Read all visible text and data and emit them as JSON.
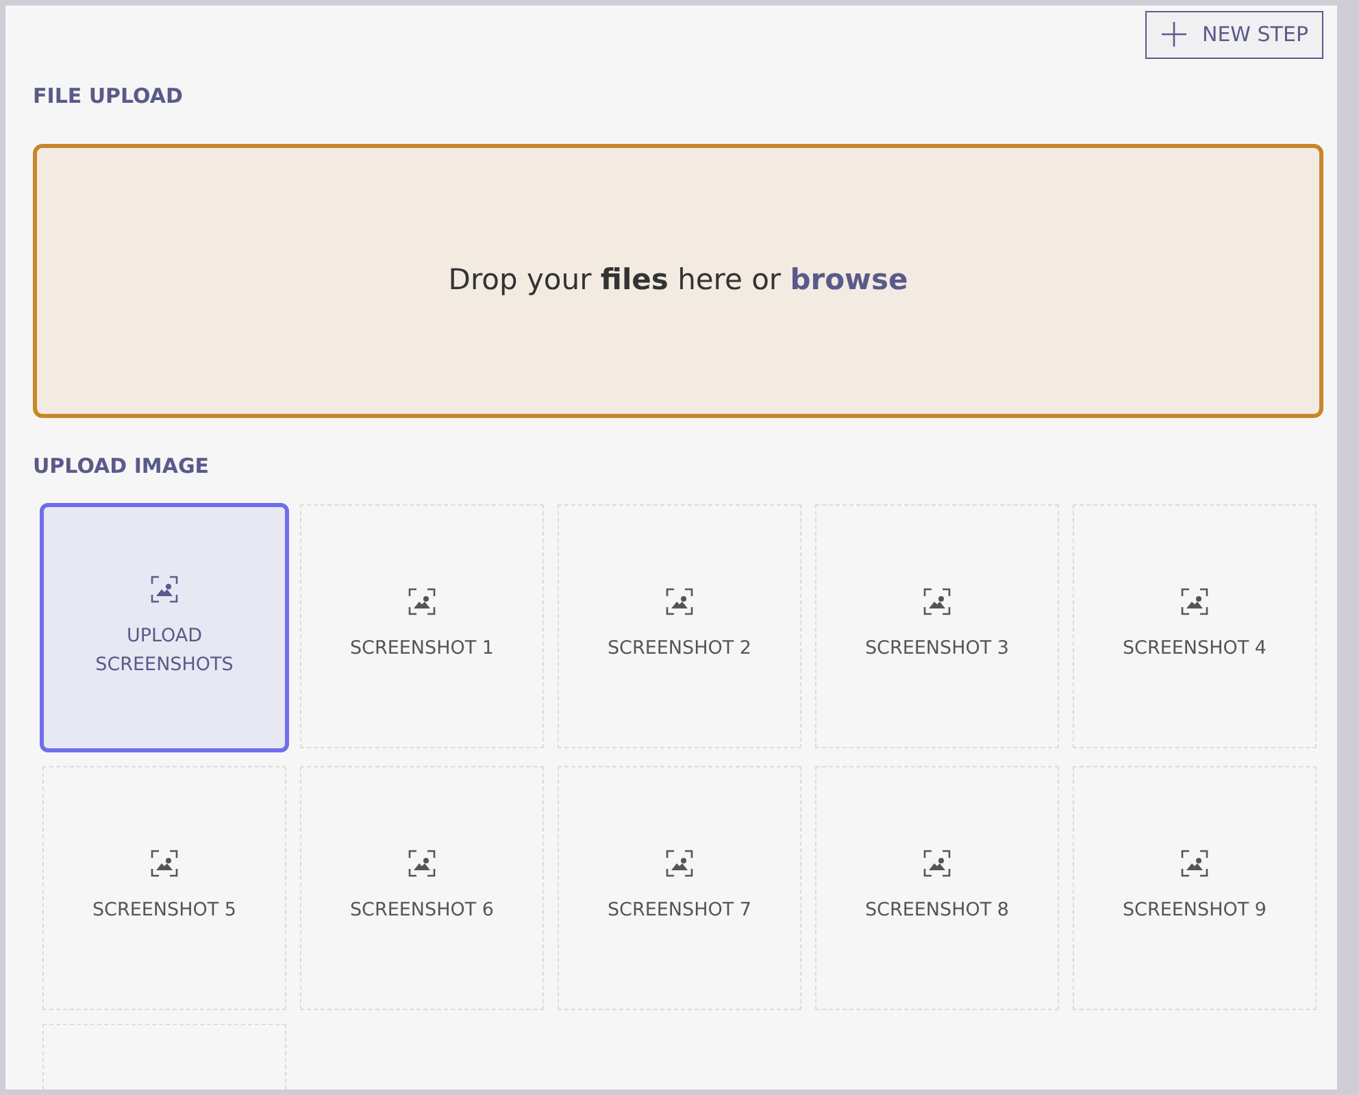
{
  "new_step_button": {
    "label": "NEW STEP"
  },
  "file_upload": {
    "title": "FILE UPLOAD",
    "dropzone_text": "Drop your **files** here or ",
    "browse_link": "browse"
  },
  "upload_image": {
    "title": "UPLOAD IMAGE",
    "tiles": [
      {
        "kind": "upload",
        "label": "UPLOAD SCREENSHOTS",
        "selected": true
      },
      {
        "kind": "screenshot",
        "label": "SCREENSHOT 1",
        "selected": false
      },
      {
        "kind": "screenshot",
        "label": "SCREENSHOT 2",
        "selected": false
      },
      {
        "kind": "screenshot",
        "label": "SCREENSHOT 3",
        "selected": false
      },
      {
        "kind": "screenshot",
        "label": "SCREENSHOT 4",
        "selected": false
      },
      {
        "kind": "screenshot",
        "label": "SCREENSHOT 5",
        "selected": false
      },
      {
        "kind": "screenshot",
        "label": "SCREENSHOT 6",
        "selected": false
      },
      {
        "kind": "screenshot",
        "label": "SCREENSHOT 7",
        "selected": false
      },
      {
        "kind": "screenshot",
        "label": "SCREENSHOT 8",
        "selected": false
      },
      {
        "kind": "screenshot",
        "label": "SCREENSHOT 9",
        "selected": false
      },
      {
        "kind": "blank",
        "selected": false
      }
    ]
  }
}
